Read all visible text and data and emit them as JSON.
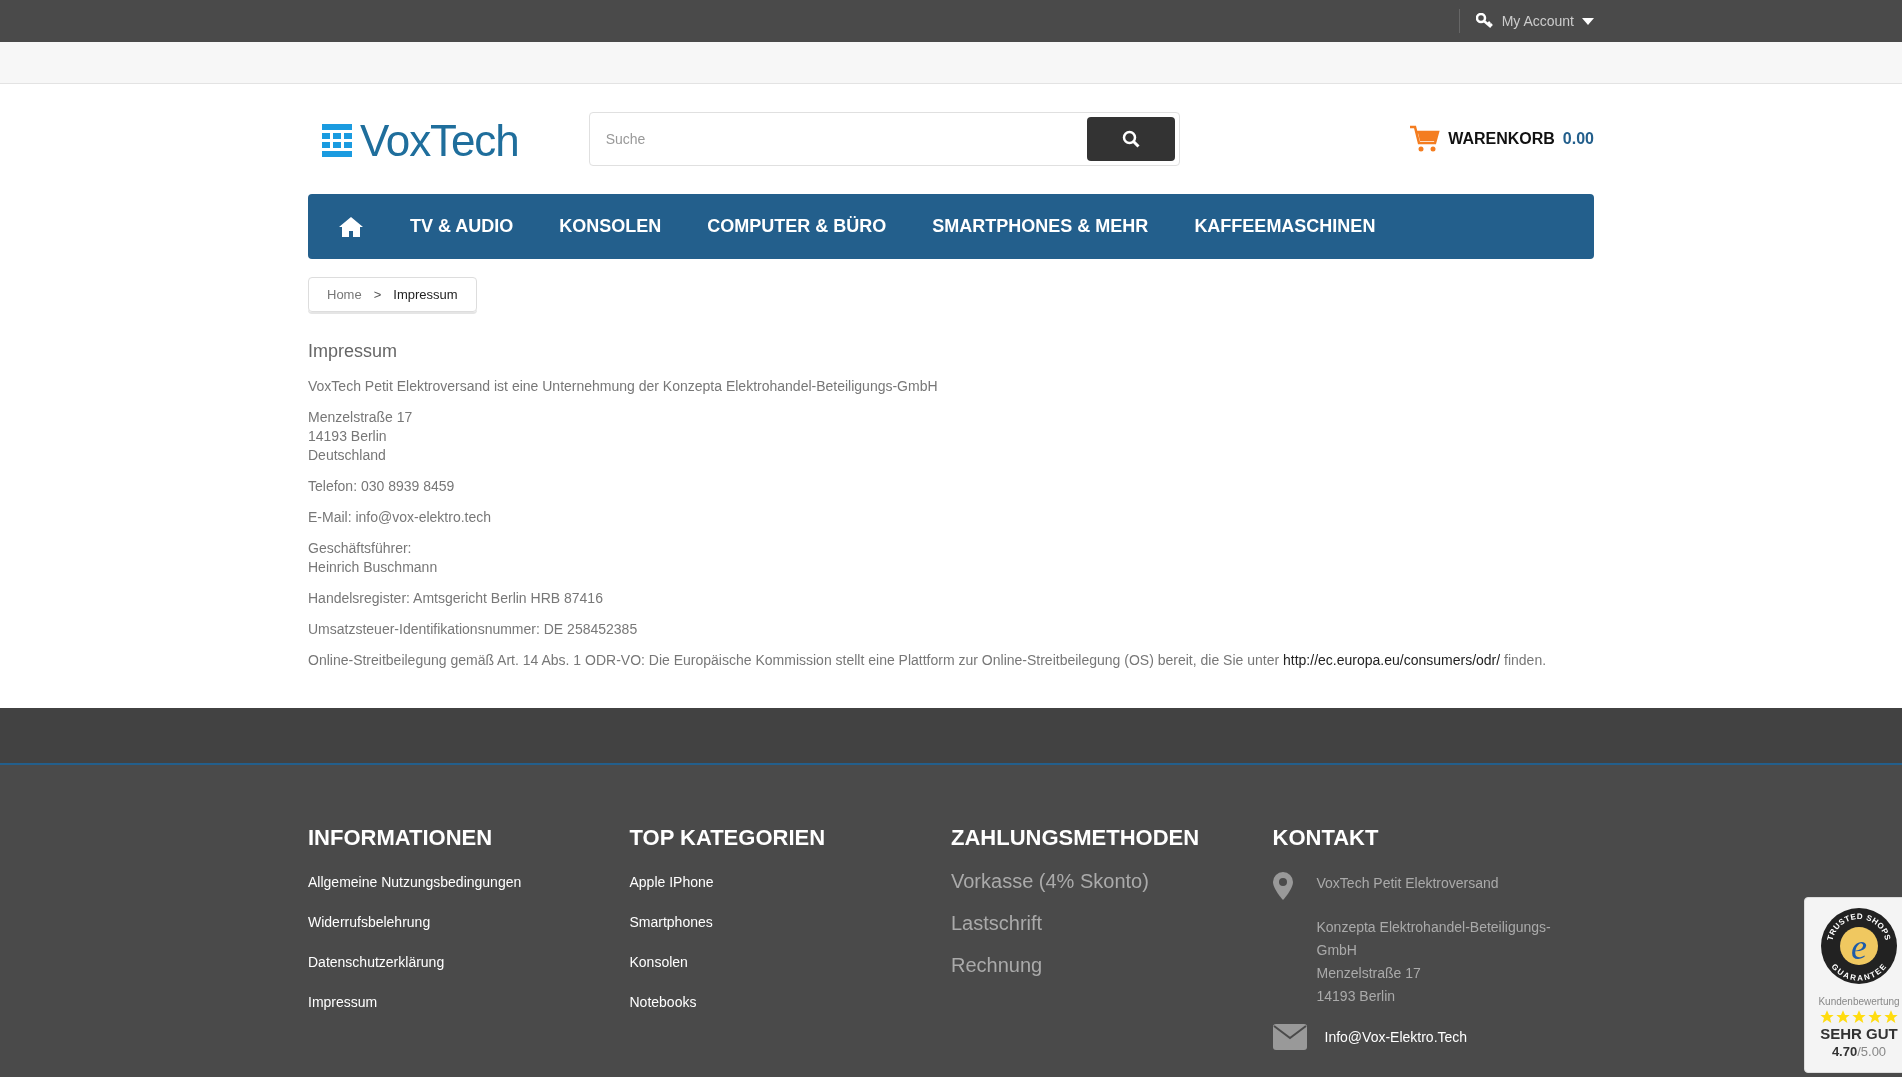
{
  "top_bar": {
    "account": "My Account"
  },
  "header": {
    "logo": "VoxTech",
    "search": {
      "placeholder": "Suche"
    },
    "cart": {
      "label": "WARENKORB",
      "amount": "0.00"
    }
  },
  "nav": {
    "items": [
      {
        "label": "TV & AUDIO"
      },
      {
        "label": "KONSOLEN"
      },
      {
        "label": "COMPUTER & BÜRO"
      },
      {
        "label": "SMARTPHONES & MEHR"
      },
      {
        "label": "KAFFEEMASCHINEN"
      }
    ]
  },
  "breadcrumb": [
    {
      "label": "Home",
      "current": false
    },
    {
      "label": "Impressum",
      "current": true
    }
  ],
  "breadcrumb_separator": ">",
  "content": {
    "title": "Impressum",
    "blocks": [
      {
        "lines": [
          "VoxTech Petit Elektroversand ist eine Unternehmung der Konzepta Elektrohandel-Beteiligungs-GmbH"
        ]
      },
      {
        "lines": [
          "Menzelstraße 17",
          "14193 Berlin",
          "Deutschland"
        ]
      },
      {
        "lines": [
          "Telefon: 030 8939 8459"
        ]
      },
      {
        "lines": [
          "E-Mail: info@vox-elektro.tech"
        ]
      },
      {
        "lines": [
          "Geschäftsführer:",
          "Heinrich Buschmann"
        ]
      },
      {
        "lines": [
          "Handelsregister: Amtsgericht Berlin HRB 87416"
        ]
      },
      {
        "lines": [
          "Umsatzsteuer-Identifikationsnummer: DE 258452385"
        ]
      }
    ],
    "odr": {
      "before": "Online-Streitbeilegung gemäß Art. 14 Abs. 1 ODR-VO: Die Europäische Kommission stellt eine Plattform zur Online-Streitbeilegung (OS) bereit, die Sie unter",
      "link": "http://ec.europa.eu/consumers/odr/",
      "after": "finden."
    }
  },
  "footer": {
    "informationen": {
      "title": "INFORMATIONEN",
      "links": [
        "Allgemeine Nutzungsbedingungen",
        "Widerrufsbelehrung",
        "Datenschutzerklärung",
        "Impressum"
      ]
    },
    "top_kategorien": {
      "title": "TOP KATEGORIEN",
      "links": [
        "Apple IPhone",
        "Smartphones",
        "Konsolen",
        "Notebooks"
      ]
    },
    "zahlungsmethoden": {
      "title": "ZAHLUNGSMETHODEN",
      "items": [
        "Vorkasse (4% Skonto)",
        "Lastschrift",
        "Rechnung"
      ]
    },
    "kontakt": {
      "title": "KONTAKT",
      "name": "VoxTech Petit Elektroversand",
      "address": [
        "Konzepta Elektrohandel-Beteiligungs-GmbH",
        "Menzelstraße 17",
        "14193 Berlin"
      ],
      "email": "Info@Vox-Elektro.Tech"
    }
  },
  "trust_badge": {
    "ring_top": "TRUSTED SHOPS",
    "ring_bottom": "GUARANTEE",
    "seal_letter": "e",
    "label": "Kundenbewertung",
    "stars": 5,
    "verdict": "SEHR GUT",
    "score": "4.70",
    "max": "/5.00"
  }
}
